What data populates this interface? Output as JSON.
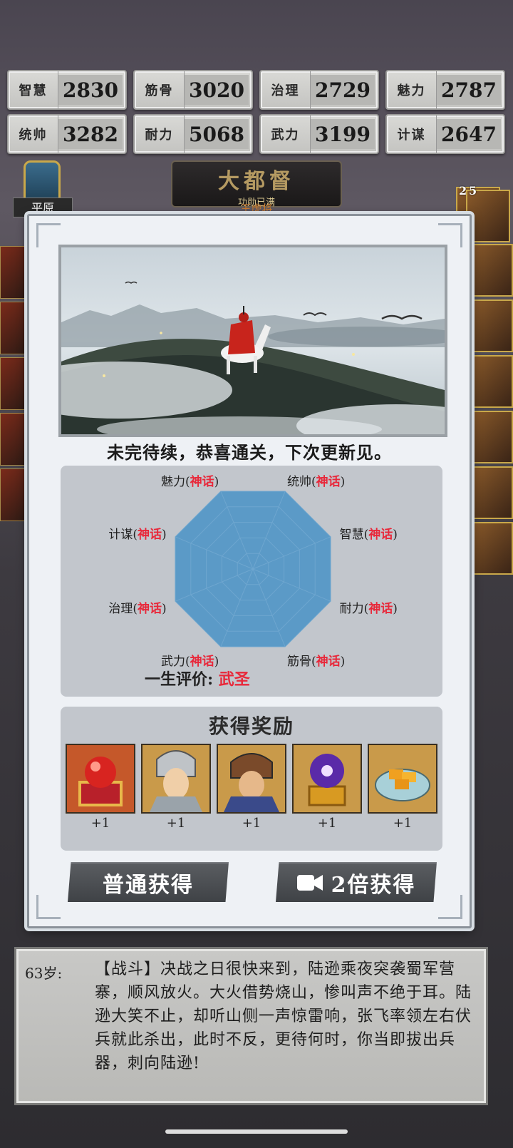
{
  "stats": [
    {
      "name": "智慧",
      "value": "2830"
    },
    {
      "name": "筋骨",
      "value": "3020"
    },
    {
      "name": "治理",
      "value": "2729"
    },
    {
      "name": "魅力",
      "value": "2787"
    },
    {
      "name": "统帅",
      "value": "3282"
    },
    {
      "name": "耐力",
      "value": "5068"
    },
    {
      "name": "武力",
      "value": "3199"
    },
    {
      "name": "计谋",
      "value": "2647"
    }
  ],
  "title_banner": {
    "main": "大都督",
    "sub": "功勋已满",
    "tail": "王虎将"
  },
  "left_emblem": {
    "label": "平原"
  },
  "right_tiles": {
    "count_1": "2",
    "count_2": "5"
  },
  "modal": {
    "message": "未完待续，恭喜通关，下次更新见。",
    "radar": {
      "axes": [
        {
          "name": "统帅",
          "level": "神话"
        },
        {
          "name": "智慧",
          "level": "神话"
        },
        {
          "name": "耐力",
          "level": "神话"
        },
        {
          "name": "筋骨",
          "level": "神话"
        },
        {
          "name": "武力",
          "level": "神话"
        },
        {
          "name": "治理",
          "level": "神话"
        },
        {
          "name": "计谋",
          "level": "神话"
        },
        {
          "name": "魅力",
          "level": "神话"
        }
      ],
      "fill_fraction": 1.0
    },
    "evaluation": {
      "label": "一生评价:",
      "value": "武圣"
    },
    "rewards": {
      "title": "获得奖励",
      "items": [
        {
          "icon": "red-orb-chest-icon",
          "count": "+1"
        },
        {
          "icon": "silver-armor-general-icon",
          "count": "+1"
        },
        {
          "icon": "helmet-general-icon",
          "count": "+1"
        },
        {
          "icon": "purple-orb-chest-icon",
          "count": "+1"
        },
        {
          "icon": "gold-bars-plate-icon",
          "count": "+1"
        }
      ]
    },
    "buttons": {
      "normal": "普通获得",
      "double": "2倍获得"
    }
  },
  "log": {
    "age": "63岁:",
    "text": "【战斗】决战之日很快来到，陆逊乘夜突袭蜀军营寨，顺风放火。大火借势烧山，惨叫声不绝于耳。陆逊大笑不止，却听山侧一声惊雷响，张飞率领左右伏兵就此杀出，此时不反，更待何时，你当即拔出兵器，刺向陆逊!"
  },
  "colors": {
    "mythic_red": "#e8283a",
    "radar_fill": "#5b9ac7",
    "panel_gray": "#c2c6cc"
  }
}
